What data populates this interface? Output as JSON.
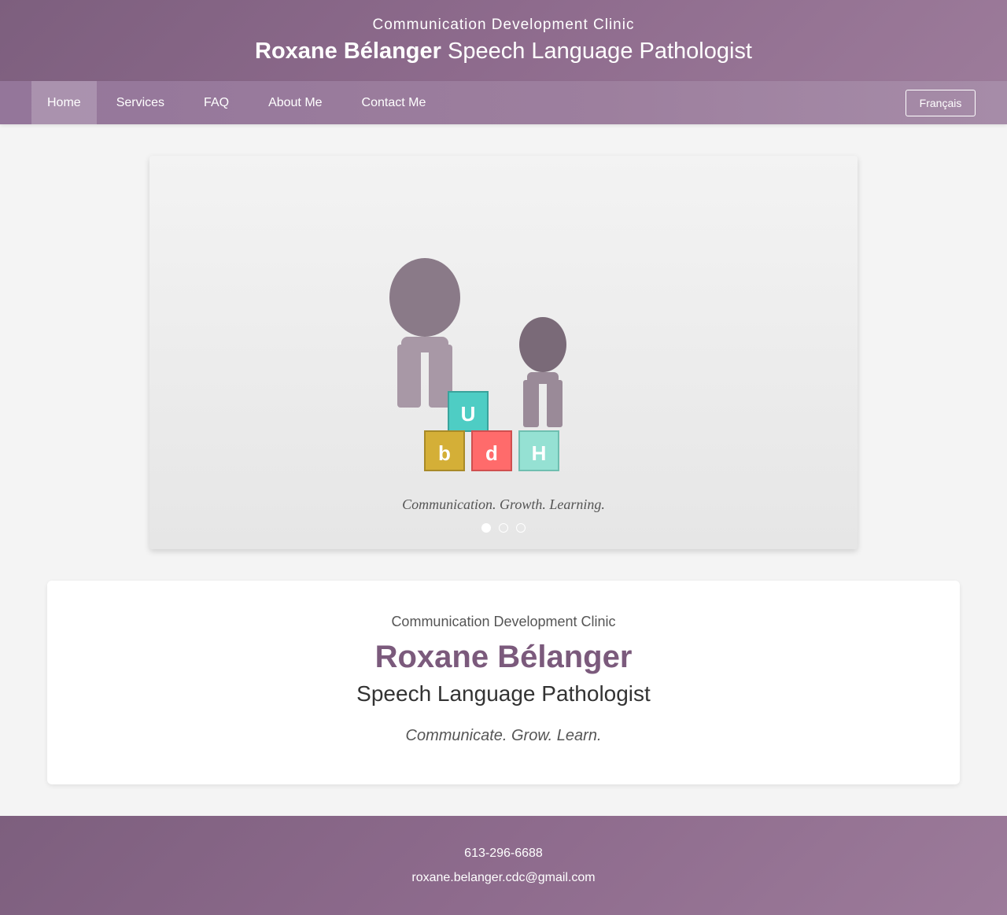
{
  "header": {
    "subtitle": "Communication Development Clinic",
    "name": "Roxane Bélanger",
    "profession": "Speech Language Pathologist"
  },
  "nav": {
    "items": [
      {
        "label": "Home",
        "active": true
      },
      {
        "label": "Services"
      },
      {
        "label": "FAQ"
      },
      {
        "label": "About Me"
      },
      {
        "label": "Contact Me"
      }
    ],
    "language_button": "Français"
  },
  "carousel": {
    "blocks": [
      "U",
      "b",
      "d",
      "H"
    ],
    "caption": "Communication. Growth. Learning.",
    "slide_count": 3,
    "active_slide": 1,
    "colors": {
      "adult_head": "#8a7a88",
      "adult_body": "#a898a6",
      "child_head": "#7a6a78",
      "child_body": "#9a8a98",
      "block_U": "#4ecdc4",
      "block_b": "#d4af37",
      "block_d": "#ff6b6b",
      "block_H": "#95e1d3"
    }
  },
  "intro": {
    "clinic": "Communication Development Clinic",
    "name": "Roxane Bélanger",
    "role": "Speech Language Pathologist",
    "tagline": "Communicate. Grow. Learn."
  },
  "footer": {
    "phone": "613-296-6688",
    "email": "roxane.belanger.cdc@gmail.com"
  }
}
